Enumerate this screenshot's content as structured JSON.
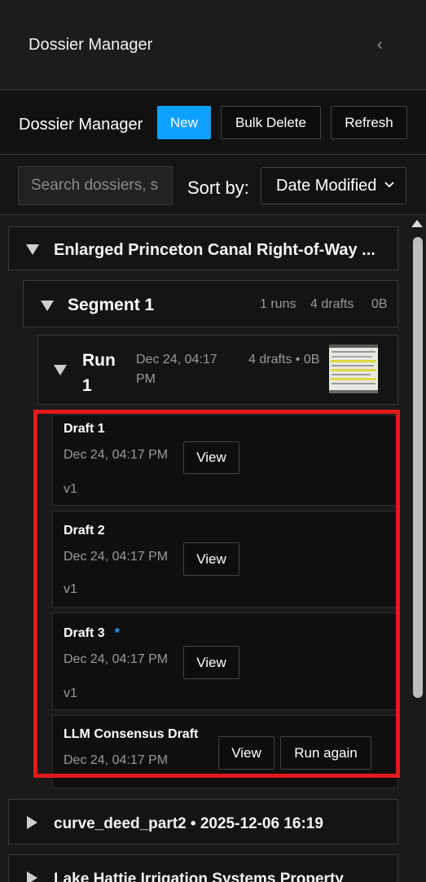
{
  "header": {
    "title": "Dossier Manager",
    "collapse_glyph": "‹"
  },
  "toolbar": {
    "title": "Dossier Manager",
    "new_label": "New",
    "bulk_delete_label": "Bulk Delete",
    "refresh_label": "Refresh"
  },
  "search": {
    "placeholder": "Search dossiers, s"
  },
  "sort": {
    "label": "Sort by:",
    "selected": "Date Modified"
  },
  "dossiers": [
    {
      "name": "Enlarged Princeton Canal Right-of-Way ...",
      "segment": {
        "name": "Segment 1",
        "runs": "1 runs",
        "drafts": "4 drafts",
        "size": "0B",
        "run": {
          "name_line1": "Run",
          "name_line2": "1",
          "date": "Dec 24, 04:17 PM",
          "meta": "4 drafts • 0B",
          "drafts": [
            {
              "name": "Draft 1",
              "date": "Dec 24, 04:17 PM",
              "version": "v1",
              "view_label": "View"
            },
            {
              "name": "Draft 2",
              "date": "Dec 24, 04:17 PM",
              "version": "v1",
              "view_label": "View"
            },
            {
              "name": "Draft 3",
              "star": "*",
              "date": "Dec 24, 04:17 PM",
              "version": "v1",
              "view_label": "View"
            },
            {
              "name": "LLM Consensus Draft",
              "date": "Dec 24, 04:17 PM",
              "view_label": "View",
              "run_again_label": "Run again"
            }
          ]
        }
      }
    },
    {
      "name": "curve_deed_part2 • 2025-12-06 16:19"
    },
    {
      "name": "Lake Hattie Irrigation Systems Property"
    }
  ],
  "colors": {
    "accent": "#0ea0ff",
    "highlight": "#e3191b",
    "llm_label": "#c8a96a",
    "star": "#2a9dff"
  }
}
